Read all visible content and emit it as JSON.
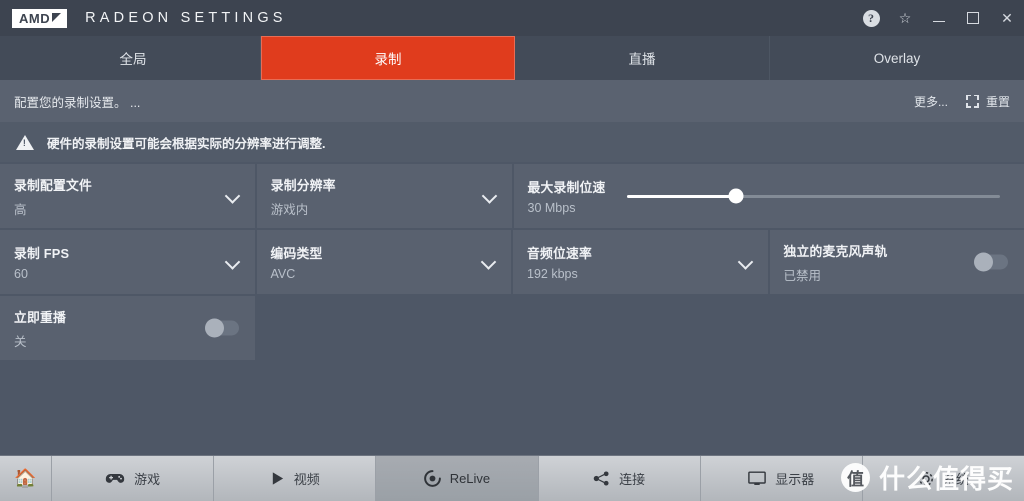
{
  "titlebar": {
    "logo_text": "AMD",
    "app_title": "RADEON SETTINGS",
    "help_label": "?",
    "star_label": "☆",
    "close_label": "✕"
  },
  "tabs": [
    {
      "label": "全局",
      "active": false
    },
    {
      "label": "录制",
      "active": true
    },
    {
      "label": "直播",
      "active": false
    },
    {
      "label": "Overlay",
      "active": false
    }
  ],
  "subheader": {
    "description": "配置您的录制设置。 ...",
    "more_label": "更多...",
    "reset_label": "重置"
  },
  "warning": {
    "text": "硬件的录制设置可能会根据实际的分辨率进行调整."
  },
  "settings": {
    "recording_profile": {
      "label": "录制配置文件",
      "value": "高"
    },
    "recording_resolution": {
      "label": "录制分辨率",
      "value": "游戏内"
    },
    "max_bitrate": {
      "label": "最大录制位速",
      "value": "30 Mbps",
      "slider_percent": 29
    },
    "recording_fps": {
      "label": "录制 FPS",
      "value": "60"
    },
    "encoding_type": {
      "label": "编码类型",
      "value": "AVC"
    },
    "audio_bitrate": {
      "label": "音频位速率",
      "value": "192 kbps"
    },
    "separate_mic_track": {
      "label": "独立的麦克风声轨",
      "value": "已禁用",
      "toggle_on": false
    },
    "instant_replay": {
      "label": "立即重播",
      "value": "关",
      "toggle_on": false
    }
  },
  "bottom_nav": [
    {
      "label": "",
      "icon": "home-icon",
      "active": false
    },
    {
      "label": "游戏",
      "icon": "gamepad-icon",
      "active": false
    },
    {
      "label": "视频",
      "icon": "play-icon",
      "active": false
    },
    {
      "label": "ReLive",
      "icon": "relive-icon",
      "active": true
    },
    {
      "label": "连接",
      "icon": "share-icon",
      "active": false
    },
    {
      "label": "显示器",
      "icon": "monitor-icon",
      "active": false
    },
    {
      "label": "系统",
      "icon": "system-icon",
      "active": false
    }
  ],
  "watermark": {
    "badge": "值",
    "text": "什么值得买"
  },
  "colors": {
    "accent": "#e03c1d",
    "titlebar": "#3d4450",
    "card": "#59616f",
    "background": "#4e5766",
    "nav": "#b9bdc2"
  }
}
